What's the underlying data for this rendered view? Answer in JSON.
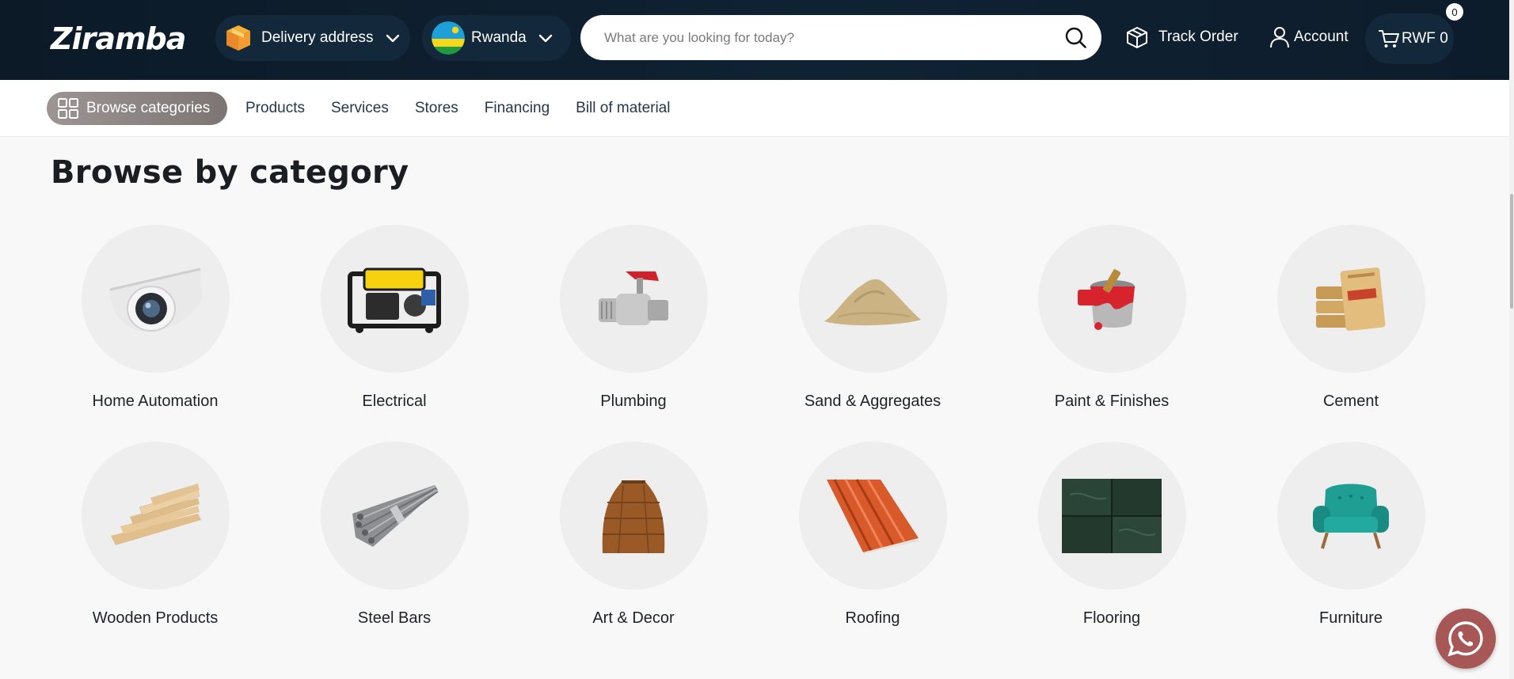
{
  "header": {
    "logo_text": "Ziramba",
    "delivery_label": "Delivery address",
    "country": "Rwanda",
    "search_placeholder": "What are you looking for today?",
    "track_order": "Track Order",
    "account": "Account",
    "cart_amount": "RWF 0",
    "cart_count": "0"
  },
  "nav": {
    "browse_label": "Browse categories",
    "links": [
      "Products",
      "Services",
      "Stores",
      "Financing",
      "Bill of material"
    ]
  },
  "main": {
    "heading": "Browse by category",
    "categories": [
      {
        "label": "Home Automation",
        "icon": "security-camera-icon"
      },
      {
        "label": "Electrical",
        "icon": "generator-icon"
      },
      {
        "label": "Plumbing",
        "icon": "valve-icon"
      },
      {
        "label": "Sand & Aggregates",
        "icon": "sand-pile-icon"
      },
      {
        "label": "Paint & Finishes",
        "icon": "paint-bucket-icon"
      },
      {
        "label": "Cement",
        "icon": "cement-bags-icon"
      },
      {
        "label": "Wooden Products",
        "icon": "wood-planks-icon"
      },
      {
        "label": "Steel Bars",
        "icon": "steel-bars-icon"
      },
      {
        "label": "Art & Decor",
        "icon": "vase-icon"
      },
      {
        "label": "Roofing",
        "icon": "roof-sheet-icon"
      },
      {
        "label": "Flooring",
        "icon": "floor-tile-icon"
      },
      {
        "label": "Furniture",
        "icon": "armchair-icon"
      }
    ]
  },
  "colors": {
    "header_bg": "#0c1a28",
    "browse_button": "#8a8382",
    "whatsapp_button": "#a85757"
  }
}
